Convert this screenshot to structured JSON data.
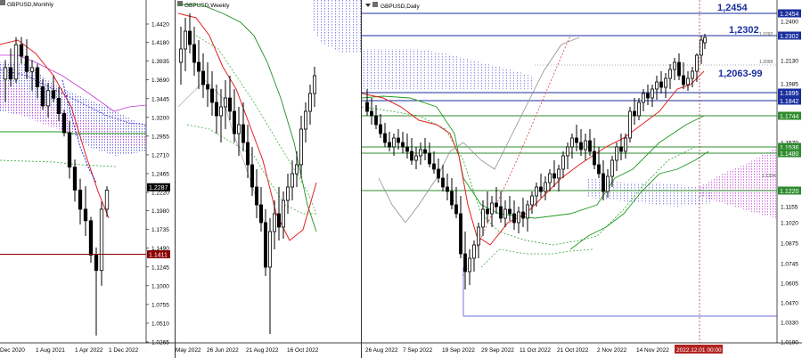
{
  "chart_data": [
    {
      "type": "candlestick",
      "title": "GBPUSD,Monthly",
      "timeframe": "Monthly",
      "x_tick_labels": [
        "Dec 2020",
        "1 Aug 2021",
        "1 Apr 2022",
        "1 Dec 2022"
      ],
      "y_tick_labels": [
        "1.4420",
        "1.4180",
        "1.3935",
        "1.3690",
        "1.3445",
        "1.3200",
        "1.2955",
        "1.2710",
        "1.2465",
        "1.2220",
        "1.1980",
        "1.1735",
        "1.1490",
        "1.1245",
        "1.1000",
        "1.0755",
        "1.0510",
        "1.0265"
      ],
      "ylim": [
        1.0265,
        1.442
      ],
      "price_tags": [
        {
          "value": "1.2287",
          "color": "#000000"
        },
        {
          "value": "1.1411",
          "color": "#8b0000"
        }
      ]
    },
    {
      "type": "candlestick",
      "title": "GBPUSD,Weekly",
      "timeframe": "Weekly",
      "x_tick_labels": [
        "May 2022",
        "26 Jun 2022",
        "21 Aug 2022",
        "16 Oct 2022"
      ]
    },
    {
      "type": "candlestick",
      "title": "GBPUSD,Daily",
      "timeframe": "Daily",
      "x_tick_labels": [
        "26 Aug 2022",
        "7 Sep 2022",
        "19 Sep 2022",
        "29 Sep 2022",
        "11 Oct 2022",
        "21 Oct 2022",
        "2 Nov 2022",
        "14 Nov 2022",
        "2022.12.01 00:00"
      ],
      "y_tick_labels": [
        "1.2400",
        "1.2130",
        "1.1985",
        "1.1570",
        "1.1425",
        "1.1155",
        "1.1020",
        "1.0875",
        "1.0745",
        "1.0605",
        "1.0470",
        "1.0330",
        "1.0190"
      ],
      "ylim": [
        1.019,
        1.246
      ],
      "annotations": [
        "1,2454",
        "1,2302",
        "1,2063-99"
      ],
      "small_labels": [
        "1.2292",
        "1.2099",
        "1.1324"
      ],
      "price_tags": [
        {
          "value": "1.2454",
          "color": "#1a2e9e"
        },
        {
          "value": "1.2302",
          "color": "#1a2e9e"
        },
        {
          "value": "1.1895",
          "color": "#1a2e9e"
        },
        {
          "value": "1.1842",
          "color": "#1a2e9e"
        },
        {
          "value": "1.1744",
          "color": "#2e8b2e"
        },
        {
          "value": "1.1536",
          "color": "#2e8b2e"
        },
        {
          "value": "1.1480",
          "color": "#2e8b2e"
        },
        {
          "value": "1.1220",
          "color": "#2e8b2e"
        }
      ]
    }
  ]
}
